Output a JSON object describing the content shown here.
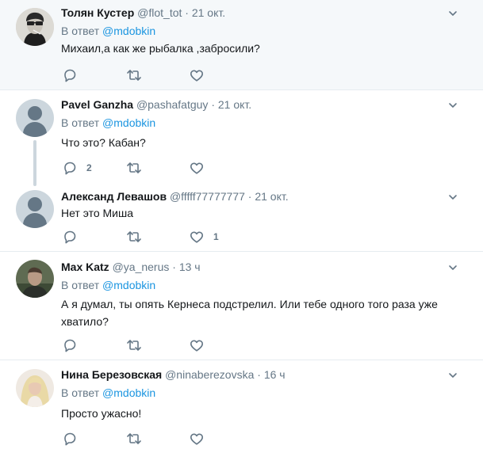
{
  "reply_prefix": "В ответ",
  "tweets": [
    {
      "name": "Толян Кустер",
      "handle": "@flot_tot",
      "time": "21 окт.",
      "reply_to": "@mdobkin",
      "text": "Михаил,а как же рыбалка ,забросили?",
      "replies": "",
      "likes": ""
    },
    {
      "name": "Pavel Ganzha",
      "handle": "@pashafatguy",
      "time": "21 окт.",
      "reply_to": "@mdobkin",
      "text": "Что это? Кабан?",
      "replies": "2",
      "likes": ""
    },
    {
      "name": "Александ Левашов",
      "handle": "@fffff77777777",
      "time": "21 окт.",
      "reply_to": "",
      "text": "Нет это Миша",
      "replies": "",
      "likes": "1"
    },
    {
      "name": "Max Katz",
      "handle": "@ya_nerus",
      "time": "13 ч",
      "reply_to": "@mdobkin",
      "text": "А я думал, ты опять Кернеса подстрелил. Или тебе одного того раза уже хватило?",
      "replies": "",
      "likes": ""
    },
    {
      "name": "Нина Березовская",
      "handle": "@ninaberezovska",
      "time": "16 ч",
      "reply_to": "@mdobkin",
      "text": "Просто ужасно!",
      "replies": "",
      "likes": ""
    }
  ],
  "colors": {
    "accent": "#1b95e0",
    "muted": "#657786",
    "highlight_bg": "#f5f8fa",
    "divider": "#e6ecf0"
  }
}
